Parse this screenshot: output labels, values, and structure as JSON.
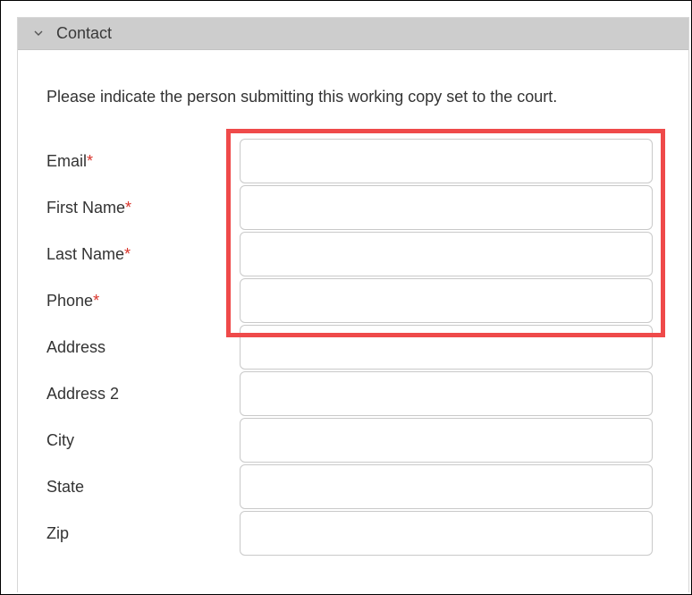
{
  "section": {
    "title": "Contact",
    "intro": "Please indicate the person submitting this working copy set to the court.",
    "required_mark": "*",
    "fields": [
      {
        "label": "Email",
        "required": true,
        "value": "",
        "placeholder": ""
      },
      {
        "label": "First Name",
        "required": true,
        "value": "",
        "placeholder": ""
      },
      {
        "label": "Last Name",
        "required": true,
        "value": "",
        "placeholder": ""
      },
      {
        "label": "Phone",
        "required": true,
        "value": "",
        "placeholder": ""
      },
      {
        "label": "Address",
        "required": false,
        "value": "",
        "placeholder": ""
      },
      {
        "label": "Address 2",
        "required": false,
        "value": "",
        "placeholder": ""
      },
      {
        "label": "City",
        "required": false,
        "value": "",
        "placeholder": ""
      },
      {
        "label": "State",
        "required": false,
        "value": "",
        "placeholder": ""
      },
      {
        "label": "Zip",
        "required": false,
        "value": "",
        "placeholder": ""
      }
    ]
  },
  "colors": {
    "header_bg": "#cdcdcd",
    "required_star": "#d9342b",
    "highlight_box": "#ef4a4a"
  },
  "icons": {
    "header_toggle": "chevron-down-icon"
  }
}
